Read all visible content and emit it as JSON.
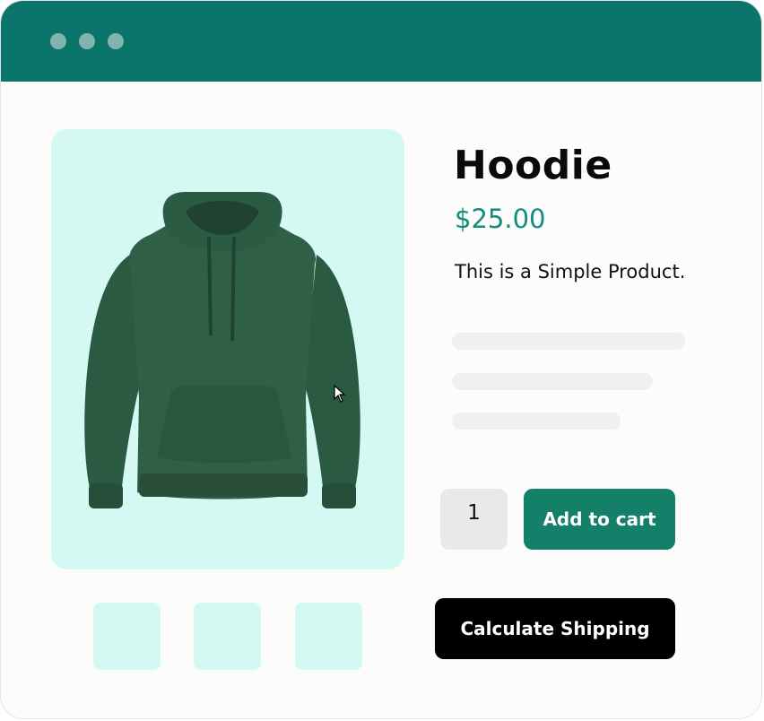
{
  "window": {
    "controls": [
      "dot",
      "dot",
      "dot"
    ]
  },
  "product": {
    "image_alt": "Green hoodie",
    "title": "Hoodie",
    "price": "$25.00",
    "description": "This is a Simple Product."
  },
  "purchase": {
    "quantity": "1",
    "add_to_cart_label": "Add to cart",
    "calculate_shipping_label": "Calculate Shipping"
  },
  "colors": {
    "titlebar": "#0b756b",
    "image_background": "#d4f9f3",
    "price": "#128c7e",
    "add_to_cart": "#14806a",
    "calculate_shipping": "#000000",
    "hoodie": "#2f5f45"
  }
}
